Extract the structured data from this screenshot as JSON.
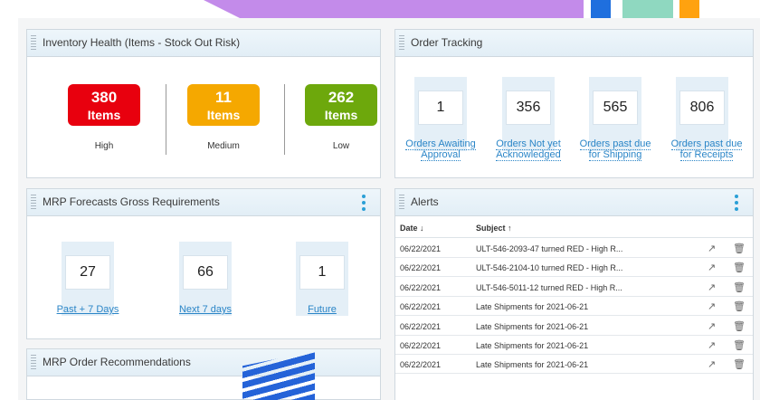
{
  "inventory": {
    "title": "Inventory Health (Items - Stock Out Risk)",
    "badges": [
      {
        "value": "380",
        "unit": "Items",
        "label": "High",
        "color": "#e8000e"
      },
      {
        "value": "11",
        "unit": "Items",
        "label": "Medium",
        "color": "#f5a800"
      },
      {
        "value": "262",
        "unit": "Items",
        "label": "Low",
        "color": "#6da80c"
      }
    ]
  },
  "orders": {
    "title": "Order Tracking",
    "tiles": [
      {
        "value": "1",
        "line1": "Orders Awaiting",
        "line2": "Approval"
      },
      {
        "value": "356",
        "line1": "Orders Not yet",
        "line2": "Acknowledged"
      },
      {
        "value": "565",
        "line1": "Orders past due",
        "line2": "for Shipping"
      },
      {
        "value": "806",
        "line1": "Orders past due",
        "line2": "for Receipts"
      }
    ]
  },
  "mrp": {
    "title": "MRP Forecasts Gross Requirements",
    "tiles": [
      {
        "value": "27",
        "label": "Past + 7 Days"
      },
      {
        "value": "66",
        "label": "Next 7 days"
      },
      {
        "value": "1",
        "label": "Future"
      }
    ]
  },
  "recommendations": {
    "title": "MRP Order Recommendations"
  },
  "alerts": {
    "title": "Alerts",
    "col_date": "Date ↓",
    "col_subject": "Subject ↑",
    "rows": [
      {
        "date": "06/22/2021",
        "subject": "ULT-546-2093-47 turned RED - High R..."
      },
      {
        "date": "06/22/2021",
        "subject": "ULT-546-2104-10 turned RED - High R..."
      },
      {
        "date": "06/22/2021",
        "subject": "ULT-546-5011-12 turned RED - High R..."
      },
      {
        "date": "06/22/2021",
        "subject": "Late Shipments for 2021-06-21"
      },
      {
        "date": "06/22/2021",
        "subject": "Late Shipments for 2021-06-21"
      },
      {
        "date": "06/22/2021",
        "subject": "Late Shipments for 2021-06-21"
      },
      {
        "date": "06/22/2021",
        "subject": "Late Shipments for 2021-06-21"
      }
    ],
    "open_icon": "external-link-icon",
    "delete_icon": "trash-icon"
  },
  "colors": {
    "accent": "#2a85c7",
    "tile_bg": "#e4eff7"
  }
}
